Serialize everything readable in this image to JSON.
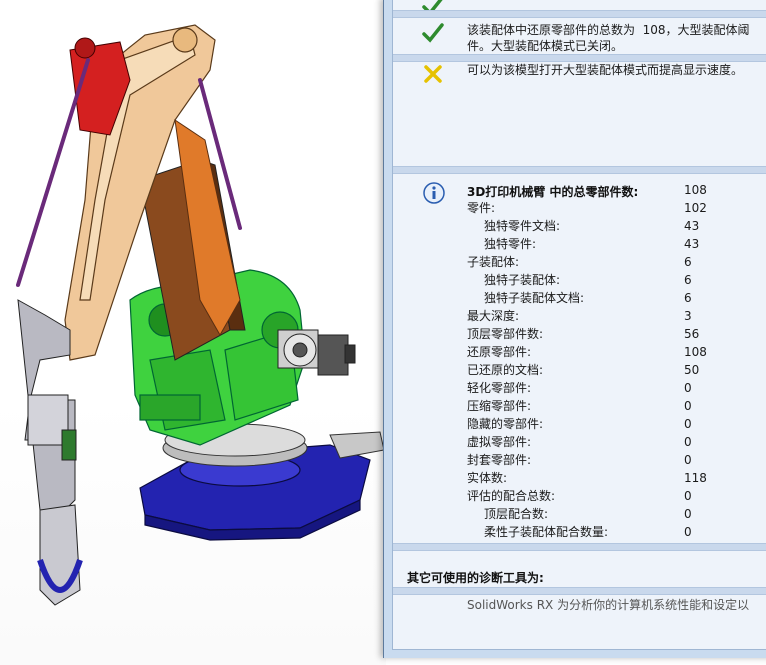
{
  "messages": [
    {
      "icon": "check-icon",
      "text": ""
    },
    {
      "icon": "check-icon",
      "text": "该装配体中还原零部件的总数为  108，大型装配体阈\n件。大型装配体模式已关闭。"
    },
    {
      "icon": "cross-icon",
      "text": "可以为该模型打开大型装配体模式而提高显示速度。"
    }
  ],
  "stats": {
    "title": "3D打印机械臂  中的总零部件数:",
    "rows": [
      {
        "label": "",
        "value": "108",
        "indent": 0
      },
      {
        "label": "零件:",
        "value": "102",
        "indent": 0
      },
      {
        "label": "独特零件文档:",
        "value": "43",
        "indent": 1
      },
      {
        "label": "独特零件:",
        "value": "43",
        "indent": 1
      },
      {
        "label": "子装配体:",
        "value": "6",
        "indent": 0
      },
      {
        "label": "独特子装配体:",
        "value": "6",
        "indent": 1
      },
      {
        "label": "独特子装配体文档:",
        "value": "6",
        "indent": 1
      },
      {
        "label": "最大深度:",
        "value": "3",
        "indent": 0
      },
      {
        "label": "顶层零部件数:",
        "value": "56",
        "indent": 0
      },
      {
        "label": "还原零部件:",
        "value": "108",
        "indent": 0
      },
      {
        "label": "已还原的文档:",
        "value": "50",
        "indent": 0
      },
      {
        "label": "轻化零部件:",
        "value": "0",
        "indent": 0
      },
      {
        "label": "压缩零部件:",
        "value": "0",
        "indent": 0
      },
      {
        "label": "隐藏的零部件:",
        "value": "0",
        "indent": 0
      },
      {
        "label": "虚拟零部件:",
        "value": "0",
        "indent": 0
      },
      {
        "label": "封套零部件:",
        "value": "0",
        "indent": 0
      },
      {
        "label": "实体数:",
        "value": "118",
        "indent": 0
      },
      {
        "label": "评估的配合总数:",
        "value": "0",
        "indent": 0
      },
      {
        "label": "顶层配合数:",
        "value": "0",
        "indent": 1
      },
      {
        "label": "柔性子装配体配合数量:",
        "value": "0",
        "indent": 1
      }
    ]
  },
  "tools": {
    "title": "其它可使用的诊断工具为:",
    "desc": "SolidWorks RX  为分析你的计算机系统性能和设定以"
  },
  "colors": {
    "check": "#2e8b2e",
    "cross": "#e6c200",
    "info": "#2a5db0",
    "arm_orange": "#f0c89a",
    "base_green": "#3fd23f",
    "base_blue": "#2323b0",
    "link_orange": "#e07a2a",
    "red_part": "#d42020",
    "rod_purple": "#c86ad8"
  }
}
